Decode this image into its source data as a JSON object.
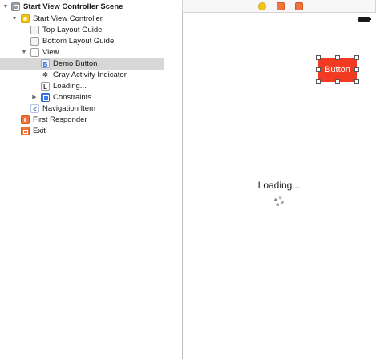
{
  "outline": {
    "items": [
      {
        "label": "Start View Controller Scene",
        "icon": "scene-icon"
      },
      {
        "label": "Start View Controller",
        "icon": "view-controller-icon"
      },
      {
        "label": "Top Layout Guide",
        "icon": "layout-guide-icon"
      },
      {
        "label": "Bottom Layout Guide",
        "icon": "layout-guide-icon"
      },
      {
        "label": "View",
        "icon": "view-icon"
      },
      {
        "label": "Demo Button",
        "icon": "button-icon",
        "icon_glyph": "B"
      },
      {
        "label": "Gray Activity Indicator",
        "icon": "activity-indicator-icon"
      },
      {
        "label": "Loading...",
        "icon": "label-icon",
        "icon_glyph": "L"
      },
      {
        "label": "Constraints",
        "icon": "constraints-icon"
      },
      {
        "label": "Navigation Item",
        "icon": "navigation-item-icon",
        "icon_glyph": "<"
      },
      {
        "label": "First Responder",
        "icon": "first-responder-icon"
      },
      {
        "label": "Exit",
        "icon": "exit-icon"
      }
    ],
    "selected": "Demo Button"
  },
  "canvas": {
    "button_label": "Button",
    "loading_label": "Loading...",
    "button_color": "#f23a22"
  },
  "colors": {
    "selection": "#d7d7d7",
    "view_controller": "#f2c318",
    "first_responder": "#f0743b",
    "constraints": "#3c7df0"
  }
}
